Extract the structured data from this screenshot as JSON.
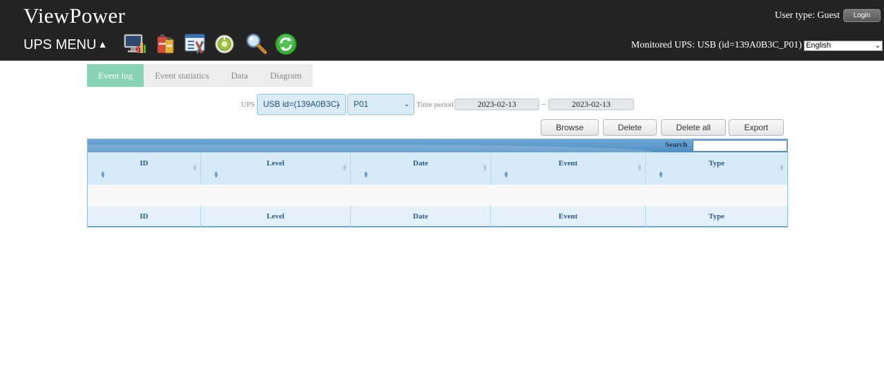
{
  "header": {
    "app_title": "ViewPower",
    "ups_menu_label": "UPS MENU",
    "ups_menu_arrow": "▲",
    "user_type_text": "User type: Guest",
    "login_label": "Login",
    "monitored_text": "Monitored UPS: USB (id=139A0B3C_P01)",
    "language_selected": "English",
    "toolbar_icons": [
      "monitor-icon",
      "battery-icon",
      "config-icon",
      "control-icon",
      "search-icon",
      "refresh-icon"
    ]
  },
  "tabs": [
    {
      "label": "Event log",
      "active": true
    },
    {
      "label": "Event statistics",
      "active": false
    },
    {
      "label": "Data",
      "active": false
    },
    {
      "label": "Diagram",
      "active": false
    }
  ],
  "filters": {
    "ups_label": "UPS",
    "ups_select": "USB id=(139A0B3C)",
    "port_select": "P01",
    "time_period_label": "Time period",
    "date_from": "2023-02-13",
    "date_separator": "--",
    "date_to": "2023-02-13"
  },
  "actions": {
    "browse": "Browse",
    "delete": "Delete",
    "delete_all": "Delete all",
    "export": "Export"
  },
  "table": {
    "search_label": "Search",
    "search_value": "",
    "columns": [
      "ID",
      "Level",
      "Date",
      "Event",
      "Type"
    ],
    "rows": []
  },
  "colors": {
    "header_bg": "#232323",
    "tab_active": "#88d2b8",
    "table_header_bg": "#d6eaf8",
    "table_bar": "#5a95c6"
  }
}
